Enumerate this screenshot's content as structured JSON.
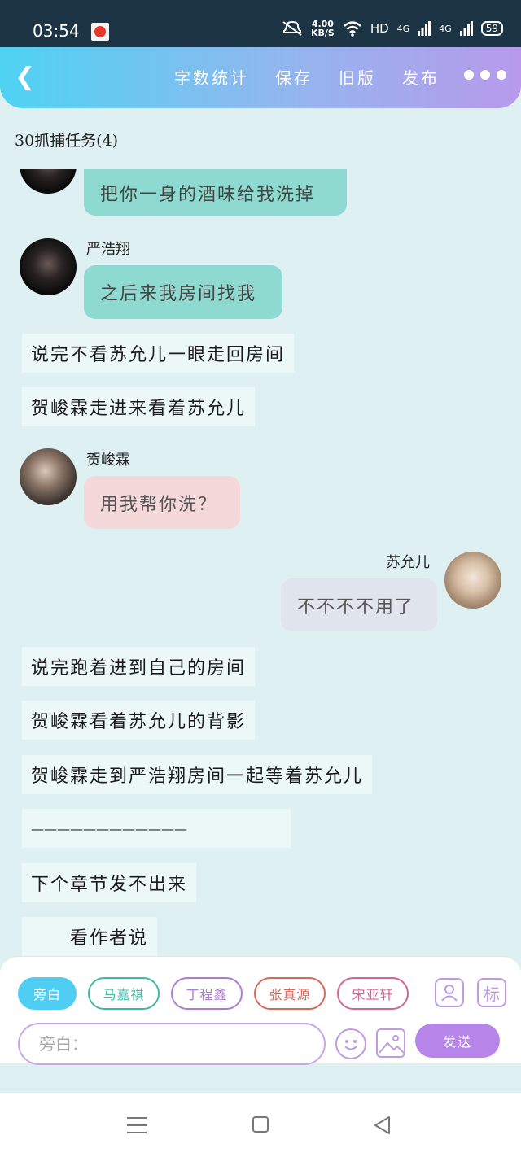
{
  "status_bar": {
    "time": "03:54",
    "speed_value": "4.00",
    "speed_unit": "KB/S",
    "network": "HD",
    "signal1": "4G",
    "signal2": "4G",
    "battery": "59"
  },
  "header": {
    "back_icon": "chevron-left-icon",
    "actions": [
      "字数统计",
      "保存",
      "旧版",
      "发布"
    ],
    "more_icon": "more-dots-icon"
  },
  "subtitle": "30抓捕任务(4)",
  "chat": {
    "m0_text": "把你一身的酒味给我洗掉",
    "m1_name": "严浩翔",
    "m1_text": "之后来我房间找我",
    "n1": "说完不看苏允儿一眼走回房间",
    "n2": "贺峻霖走进来看着苏允儿",
    "m2_name": "贺峻霖",
    "m2_text": "用我帮你洗？",
    "m3_name": "苏允儿",
    "m3_text": "不不不不用了",
    "n3": "说完跑着进到自己的房间",
    "n4": "贺峻霖看着苏允儿的背影",
    "n5": "贺峻霖走到严浩翔房间一起等着苏允儿",
    "n6": "————————————",
    "n7": "下个章节发不出来",
    "n8": "　　看作者说"
  },
  "input_panel": {
    "chips": [
      "旁白",
      "马嘉祺",
      "丁程鑫",
      "张真源",
      "宋亚轩"
    ],
    "tool_role_icon": "person-card-icon",
    "tool_mark_label": "标",
    "input_placeholder": "旁白：",
    "emoji_icon": "smiley-icon",
    "image_icon": "image-icon",
    "send_label": "发送"
  },
  "colors": {
    "background": "#dff0f2",
    "header_gradient_start": "#4fd3f2",
    "header_gradient_end": "#b89aec",
    "teal_bubble": "#8fdad0",
    "pink_bubble": "#f5d9da",
    "grey_bubble": "#dfe4ed",
    "send_button": "#b784e9"
  }
}
